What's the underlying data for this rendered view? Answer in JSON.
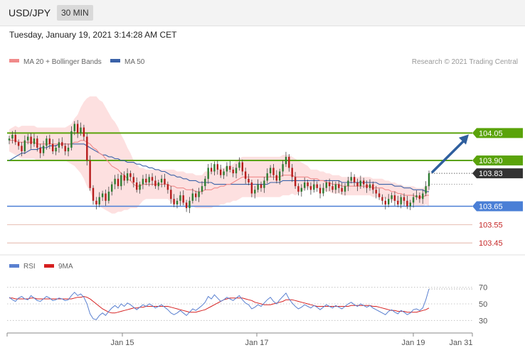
{
  "header": {
    "symbol": "USD/JPY",
    "timeframe": "30 MIN"
  },
  "timestamp": "Tuesday, January 19, 2021 3:14:28 AM CET",
  "legend": {
    "ma20": "MA 20 + Bollinger Bands",
    "ma50": "MA 50",
    "ma20_color": "#f08a8a",
    "ma50_color": "#3a62a8"
  },
  "credit": "Research © 2021 Trading Central",
  "colors": {
    "up": "#2e7d32",
    "down": "#b71c1c",
    "green_level": "#5aa30a",
    "blue_level": "#4a7fd6",
    "red_level": "#c62828",
    "current": "#333333",
    "band_fill": "#fde0e0",
    "rsi": "#5a80d0",
    "rsi_ma": "#d62020"
  },
  "chart_data": [
    {
      "type": "candlestick",
      "ylim": [
        103.4,
        104.35
      ],
      "x_labels": [
        "Jan 15",
        "Jan 17",
        "Jan 19",
        "Jan 31"
      ],
      "levels": [
        {
          "value": 104.05,
          "label": "104.05",
          "style": "resistance"
        },
        {
          "value": 103.9,
          "label": "103.90",
          "style": "resistance"
        },
        {
          "value": 103.83,
          "label": "103.83",
          "style": "current"
        },
        {
          "value": 103.65,
          "label": "103.65",
          "style": "support"
        },
        {
          "value": 103.55,
          "label": "103.55",
          "style": "minor"
        },
        {
          "value": 103.45,
          "label": "103.45",
          "style": "minor"
        }
      ],
      "close": [
        104.02,
        104.04,
        104.0,
        103.98,
        103.95,
        104.01,
        104.03,
        103.99,
        104.02,
        103.97,
        103.94,
        103.98,
        104.02,
        103.99,
        103.95,
        103.97,
        104.0,
        103.98,
        103.95,
        103.97,
        104.06,
        104.1,
        104.05,
        104.08,
        104.03,
        103.9,
        103.75,
        103.68,
        103.66,
        103.7,
        103.72,
        103.68,
        103.73,
        103.77,
        103.8,
        103.76,
        103.82,
        103.79,
        103.83,
        103.81,
        103.78,
        103.74,
        103.77,
        103.8,
        103.78,
        103.81,
        103.79,
        103.76,
        103.78,
        103.8,
        103.77,
        103.74,
        103.69,
        103.66,
        103.68,
        103.71,
        103.67,
        103.64,
        103.68,
        103.72,
        103.7,
        103.73,
        103.76,
        103.8,
        103.86,
        103.84,
        103.88,
        103.85,
        103.82,
        103.84,
        103.87,
        103.85,
        103.83,
        103.86,
        103.89,
        103.84,
        103.8,
        103.78,
        103.72,
        103.74,
        103.77,
        103.75,
        103.79,
        103.83,
        103.86,
        103.82,
        103.79,
        103.84,
        103.88,
        103.92,
        103.86,
        103.81,
        103.76,
        103.73,
        103.75,
        103.78,
        103.76,
        103.74,
        103.77,
        103.75,
        103.72,
        103.75,
        103.78,
        103.76,
        103.74,
        103.77,
        103.75,
        103.73,
        103.76,
        103.79,
        103.81,
        103.78,
        103.76,
        103.79,
        103.77,
        103.75,
        103.77,
        103.74,
        103.72,
        103.7,
        103.68,
        103.66,
        103.69,
        103.71,
        103.68,
        103.66,
        103.7,
        103.68,
        103.65,
        103.67,
        103.7,
        103.71,
        103.69,
        103.72,
        103.76,
        103.83
      ],
      "ma20": [
        104.01,
        104.01,
        104.01,
        104.0,
        104.0,
        104.0,
        104.0,
        104.0,
        104.0,
        103.99,
        103.99,
        103.99,
        103.99,
        103.99,
        103.99,
        103.99,
        103.99,
        103.99,
        103.99,
        103.99,
        103.99,
        104.0,
        104.0,
        104.01,
        104.01,
        104.0,
        103.99,
        103.97,
        103.96,
        103.94,
        103.93,
        103.91,
        103.89,
        103.87,
        103.86,
        103.85,
        103.83,
        103.82,
        103.8,
        103.79,
        103.77,
        103.76,
        103.76,
        103.77,
        103.77,
        103.77,
        103.77,
        103.77,
        103.77,
        103.77,
        103.77,
        103.77,
        103.76,
        103.76,
        103.75,
        103.75,
        103.75,
        103.74,
        103.74,
        103.74,
        103.73,
        103.73,
        103.73,
        103.74,
        103.74,
        103.74,
        103.75,
        103.75,
        103.76,
        103.76,
        103.77,
        103.77,
        103.78,
        103.79,
        103.8,
        103.81,
        103.81,
        103.81,
        103.81,
        103.81,
        103.81,
        103.81,
        103.81,
        103.81,
        103.81,
        103.81,
        103.81,
        103.81,
        103.82,
        103.82,
        103.82,
        103.82,
        103.81,
        103.81,
        103.81,
        103.81,
        103.81,
        103.8,
        103.8,
        103.8,
        103.79,
        103.79,
        103.78,
        103.78,
        103.77,
        103.77,
        103.77,
        103.76,
        103.76,
        103.76,
        103.76,
        103.76,
        103.76,
        103.76,
        103.76,
        103.76,
        103.76,
        103.75,
        103.75,
        103.75,
        103.75,
        103.74,
        103.74,
        103.73,
        103.73,
        103.72,
        103.72,
        103.71,
        103.71,
        103.71,
        103.71,
        103.7,
        103.7,
        103.7,
        103.71,
        103.71
      ],
      "ma50": [
        103.9,
        103.91,
        103.92,
        103.93,
        103.94,
        103.94,
        103.95,
        103.96,
        103.96,
        103.96,
        103.97,
        103.97,
        103.97,
        103.98,
        103.98,
        103.98,
        103.99,
        103.99,
        103.99,
        103.99,
        103.99,
        103.99,
        103.99,
        103.99,
        103.99,
        103.98,
        103.97,
        103.96,
        103.95,
        103.94,
        103.93,
        103.93,
        103.92,
        103.92,
        103.91,
        103.91,
        103.9,
        103.9,
        103.89,
        103.89,
        103.89,
        103.88,
        103.88,
        103.87,
        103.87,
        103.86,
        103.86,
        103.85,
        103.85,
        103.84,
        103.84,
        103.83,
        103.82,
        103.82,
        103.81,
        103.81,
        103.8,
        103.8,
        103.79,
        103.79,
        103.79,
        103.78,
        103.78,
        103.78,
        103.78,
        103.78,
        103.77,
        103.77,
        103.77,
        103.77,
        103.77,
        103.77,
        103.77,
        103.77,
        103.77,
        103.77,
        103.77,
        103.77,
        103.77,
        103.77,
        103.77,
        103.77,
        103.77,
        103.77,
        103.78,
        103.78,
        103.78,
        103.78,
        103.79,
        103.79,
        103.79,
        103.79,
        103.79,
        103.79,
        103.79,
        103.79,
        103.79,
        103.79,
        103.79,
        103.79,
        103.79,
        103.79,
        103.79,
        103.79,
        103.79,
        103.79,
        103.79,
        103.78,
        103.78,
        103.78,
        103.78,
        103.78,
        103.78,
        103.78,
        103.78,
        103.78,
        103.78,
        103.78,
        103.78,
        103.77,
        103.77,
        103.77,
        103.77,
        103.77,
        103.76,
        103.76,
        103.76,
        103.75,
        103.75,
        103.75,
        103.74,
        103.74,
        103.74,
        103.74,
        103.73,
        103.73
      ],
      "band_width": [
        0.06,
        0.07,
        0.08,
        0.08,
        0.09,
        0.09,
        0.09,
        0.09,
        0.09,
        0.09,
        0.09,
        0.09,
        0.09,
        0.09,
        0.09,
        0.09,
        0.09,
        0.09,
        0.09,
        0.1,
        0.11,
        0.13,
        0.15,
        0.18,
        0.21,
        0.24,
        0.26,
        0.28,
        0.29,
        0.29,
        0.29,
        0.28,
        0.27,
        0.26,
        0.25,
        0.23,
        0.21,
        0.19,
        0.17,
        0.15,
        0.13,
        0.12,
        0.1,
        0.09,
        0.08,
        0.08,
        0.08,
        0.08,
        0.08,
        0.08,
        0.08,
        0.08,
        0.09,
        0.09,
        0.09,
        0.09,
        0.09,
        0.09,
        0.09,
        0.09,
        0.09,
        0.09,
        0.09,
        0.1,
        0.1,
        0.1,
        0.1,
        0.1,
        0.1,
        0.1,
        0.1,
        0.1,
        0.1,
        0.11,
        0.11,
        0.11,
        0.11,
        0.11,
        0.11,
        0.11,
        0.11,
        0.11,
        0.11,
        0.11,
        0.11,
        0.11,
        0.11,
        0.11,
        0.11,
        0.11,
        0.11,
        0.1,
        0.1,
        0.09,
        0.08,
        0.07,
        0.06,
        0.05,
        0.05,
        0.05,
        0.05,
        0.05,
        0.05,
        0.05,
        0.05,
        0.05,
        0.05,
        0.05,
        0.05,
        0.05,
        0.05,
        0.05,
        0.05,
        0.05,
        0.05,
        0.05,
        0.05,
        0.05,
        0.05,
        0.05,
        0.05,
        0.05,
        0.05,
        0.05,
        0.05,
        0.05,
        0.05,
        0.05,
        0.05,
        0.05,
        0.05,
        0.05,
        0.05,
        0.05,
        0.05,
        0.06
      ],
      "forecast_arrow": {
        "from": 103.83,
        "to": 104.05
      }
    },
    {
      "type": "line",
      "legend": [
        "RSI",
        "9MA"
      ],
      "ylim": [
        20,
        80
      ],
      "y_ticks": [
        70,
        50,
        30
      ],
      "series": [
        {
          "name": "RSI",
          "values": [
            58,
            55,
            53,
            57,
            59,
            56,
            55,
            60,
            57,
            54,
            53,
            56,
            59,
            57,
            54,
            55,
            57,
            56,
            54,
            55,
            60,
            64,
            60,
            62,
            58,
            50,
            38,
            32,
            31,
            36,
            39,
            36,
            41,
            45,
            48,
            45,
            50,
            47,
            51,
            49,
            46,
            43,
            46,
            49,
            47,
            50,
            48,
            45,
            47,
            49,
            46,
            43,
            39,
            37,
            39,
            42,
            39,
            36,
            40,
            44,
            42,
            45,
            48,
            52,
            59,
            56,
            61,
            57,
            53,
            55,
            58,
            56,
            54,
            57,
            60,
            55,
            51,
            49,
            44,
            46,
            49,
            47,
            51,
            55,
            58,
            53,
            50,
            55,
            59,
            63,
            56,
            51,
            47,
            44,
            46,
            49,
            47,
            45,
            48,
            46,
            43,
            46,
            49,
            47,
            45,
            48,
            46,
            44,
            47,
            50,
            52,
            49,
            47,
            50,
            48,
            46,
            48,
            45,
            43,
            41,
            39,
            37,
            41,
            43,
            40,
            38,
            42,
            40,
            37,
            39,
            43,
            44,
            42,
            45,
            55,
            68
          ]
        },
        {
          "name": "9MA",
          "values": [
            57,
            57,
            56,
            56,
            56,
            56,
            56,
            57,
            57,
            56,
            56,
            56,
            56,
            56,
            56,
            56,
            56,
            56,
            56,
            56,
            56,
            57,
            58,
            58,
            59,
            58,
            56,
            53,
            50,
            47,
            44,
            42,
            40,
            39,
            39,
            40,
            41,
            42,
            43,
            44,
            45,
            45,
            46,
            46,
            47,
            47,
            47,
            47,
            47,
            47,
            47,
            47,
            46,
            45,
            44,
            43,
            42,
            41,
            40,
            40,
            40,
            41,
            42,
            43,
            45,
            47,
            49,
            51,
            53,
            55,
            56,
            57,
            57,
            57,
            57,
            57,
            56,
            55,
            54,
            52,
            51,
            50,
            49,
            49,
            49,
            50,
            51,
            52,
            53,
            55,
            55,
            55,
            54,
            53,
            52,
            51,
            50,
            49,
            48,
            47,
            47,
            47,
            47,
            47,
            47,
            47,
            47,
            47,
            47,
            47,
            48,
            48,
            48,
            48,
            48,
            48,
            48,
            47,
            47,
            46,
            45,
            44,
            43,
            42,
            42,
            41,
            41,
            41,
            40,
            40,
            40,
            40,
            41,
            42,
            43,
            45
          ]
        }
      ]
    }
  ]
}
